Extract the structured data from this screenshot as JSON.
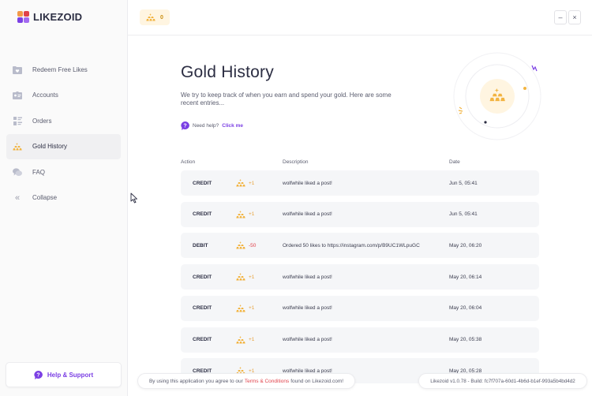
{
  "app": {
    "name": "LIKEZOID",
    "brand_color": "#7b3fe4",
    "gold_color": "#f2b441"
  },
  "sidebar": {
    "items": [
      {
        "label": "Redeem Free Likes",
        "icon": "heart-folder-icon",
        "active": false
      },
      {
        "label": "Accounts",
        "icon": "id-card-icon",
        "active": false
      },
      {
        "label": "Orders",
        "icon": "orders-list-icon",
        "active": false
      },
      {
        "label": "Gold History",
        "icon": "gold-bars-icon",
        "active": true
      },
      {
        "label": "FAQ",
        "icon": "chat-bubbles-icon",
        "active": false
      },
      {
        "label": "Collapse",
        "icon": "double-chevron-left-icon",
        "active": false
      }
    ],
    "support_label": "Help & Support"
  },
  "topbar": {
    "gold_balance": "0",
    "minimize": "–",
    "close": "×"
  },
  "main": {
    "title": "Gold History",
    "subtitle": "We try to keep track of when you earn and spend your gold. Here are some recent entries...",
    "help_text": "Need help?",
    "help_link": "Click me"
  },
  "table": {
    "headers": {
      "action": "Action",
      "description": "Description",
      "date": "Date"
    },
    "rows": [
      {
        "action": "CREDIT",
        "amount": "+1",
        "type": "credit",
        "description": "wolfwhile liked a post!",
        "date": "Jun 5, 05:41"
      },
      {
        "action": "CREDIT",
        "amount": "+1",
        "type": "credit",
        "description": "wolfwhile liked a post!",
        "date": "Jun 5, 05:41"
      },
      {
        "action": "DEBIT",
        "amount": "-50",
        "type": "debit",
        "description": "Ordered 50 likes to https://instagram.com/p/B9UC1WLpuGC",
        "date": "May 20, 06:20"
      },
      {
        "action": "CREDIT",
        "amount": "+1",
        "type": "credit",
        "description": "wolfwhile liked a post!",
        "date": "May 20, 06:14"
      },
      {
        "action": "CREDIT",
        "amount": "+1",
        "type": "credit",
        "description": "wolfwhile liked a post!",
        "date": "May 20, 06:04"
      },
      {
        "action": "CREDIT",
        "amount": "+1",
        "type": "credit",
        "description": "wolfwhile liked a post!",
        "date": "May 20, 05:38"
      },
      {
        "action": "CREDIT",
        "amount": "+1",
        "type": "credit",
        "description": "wolfwhile liked a post!",
        "date": "May 20, 05:28"
      }
    ]
  },
  "footer": {
    "terms_prefix": "By using this application you agree to our",
    "terms_link": "Terms & Conditions",
    "terms_suffix": "found on Likezoid.com!",
    "version": "Likezoid v1.0.78 - Build: fc7f707a-60d1-4b6d-b1ef-993a5b4bd4d2"
  }
}
